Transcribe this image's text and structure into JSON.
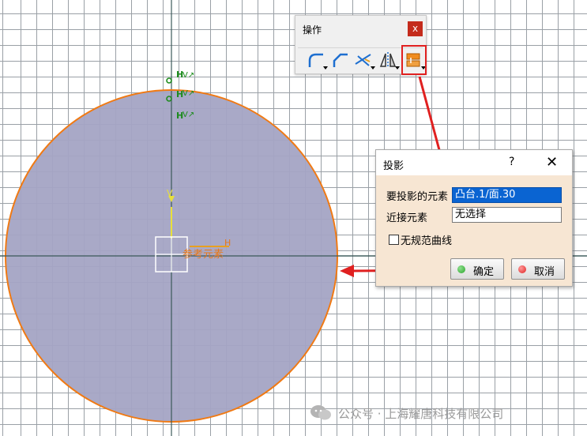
{
  "toolbar": {
    "title": "操作",
    "close_label": "x",
    "tools": [
      {
        "icon": "fillet-icon"
      },
      {
        "icon": "chamfer-icon"
      },
      {
        "icon": "trim-icon"
      },
      {
        "icon": "mirror-icon"
      },
      {
        "icon": "projection-icon"
      }
    ]
  },
  "canvas": {
    "reference_label": "参考元素",
    "axis_v_label": "V",
    "axis_h_label": "H",
    "circle_fill": "#a4a4c4",
    "circle_stroke": "#f07a14"
  },
  "dialog": {
    "title": "投影",
    "help_label": "?",
    "close_label": "✕",
    "fields": [
      {
        "label": "要投影的元素",
        "value": "凸台.1/面.30",
        "selected": true
      },
      {
        "label": "近接元素",
        "value": "无选择",
        "selected": false
      }
    ],
    "checkbox_label": "无规范曲线",
    "ok_label": "确定",
    "cancel_label": "取消"
  },
  "watermark": {
    "text": "公众号 · 上海耀唐科技有限公司"
  },
  "colors": {
    "annotation_arrow": "#e02020",
    "ok_dot": "#2aa52a",
    "cancel_dot": "#e02020",
    "constraint_green": "#1e8c1e"
  }
}
